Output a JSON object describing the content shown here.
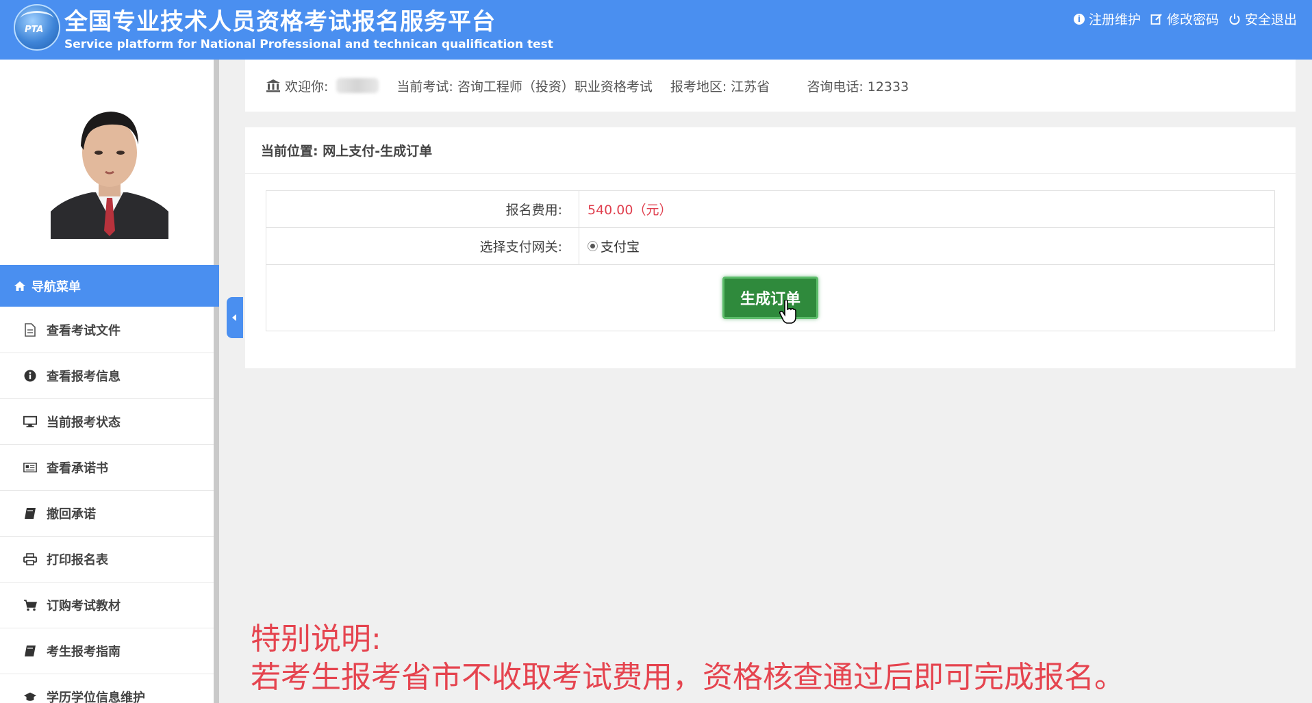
{
  "header": {
    "title_cn": "全国专业技术人员资格考试报名服务平台",
    "title_en": "Service platform for National Professional and technican qualification test",
    "links": [
      {
        "label": "注册维护",
        "icon": "info-icon"
      },
      {
        "label": "修改密码",
        "icon": "edit-icon"
      },
      {
        "label": "安全退出",
        "icon": "power-icon"
      }
    ]
  },
  "sidebar": {
    "nav_header": "导航菜单",
    "items": [
      {
        "label": "查看考试文件",
        "icon": "document-icon"
      },
      {
        "label": "查看报考信息",
        "icon": "info-icon"
      },
      {
        "label": "当前报考状态",
        "icon": "monitor-icon"
      },
      {
        "label": "查看承诺书",
        "icon": "newspaper-icon"
      },
      {
        "label": "撤回承诺",
        "icon": "book-icon"
      },
      {
        "label": "打印报名表",
        "icon": "print-icon"
      },
      {
        "label": "订购考试教材",
        "icon": "cart-icon"
      },
      {
        "label": "考生报考指南",
        "icon": "book-icon"
      },
      {
        "label": "学历学位信息维护",
        "icon": "graduation-cap-icon"
      }
    ]
  },
  "infobar": {
    "welcome": "欢迎你:",
    "current_exam": "当前考试: 咨询工程师（投资）职业资格考试",
    "region": "报考地区: 江苏省",
    "phone": "咨询电话:  12333"
  },
  "panel": {
    "breadcrumb": "当前位置: 网上支付-生成订单",
    "fee_label": "报名费用:",
    "fee_value": "540.00（元）",
    "gateway_label": "选择支付网关:",
    "gateway_option": "支付宝",
    "submit_label": "生成订单"
  },
  "notice": {
    "line1": "特别说明:",
    "line2": "若考生报考省市不收取考试费用，资格核查通过后即可完成报名。"
  },
  "colors": {
    "header_blue": "#4a8ff0",
    "button_green": "#2f8a3c",
    "fee_red": "#e0404f",
    "notice_red": "#e5444f"
  }
}
